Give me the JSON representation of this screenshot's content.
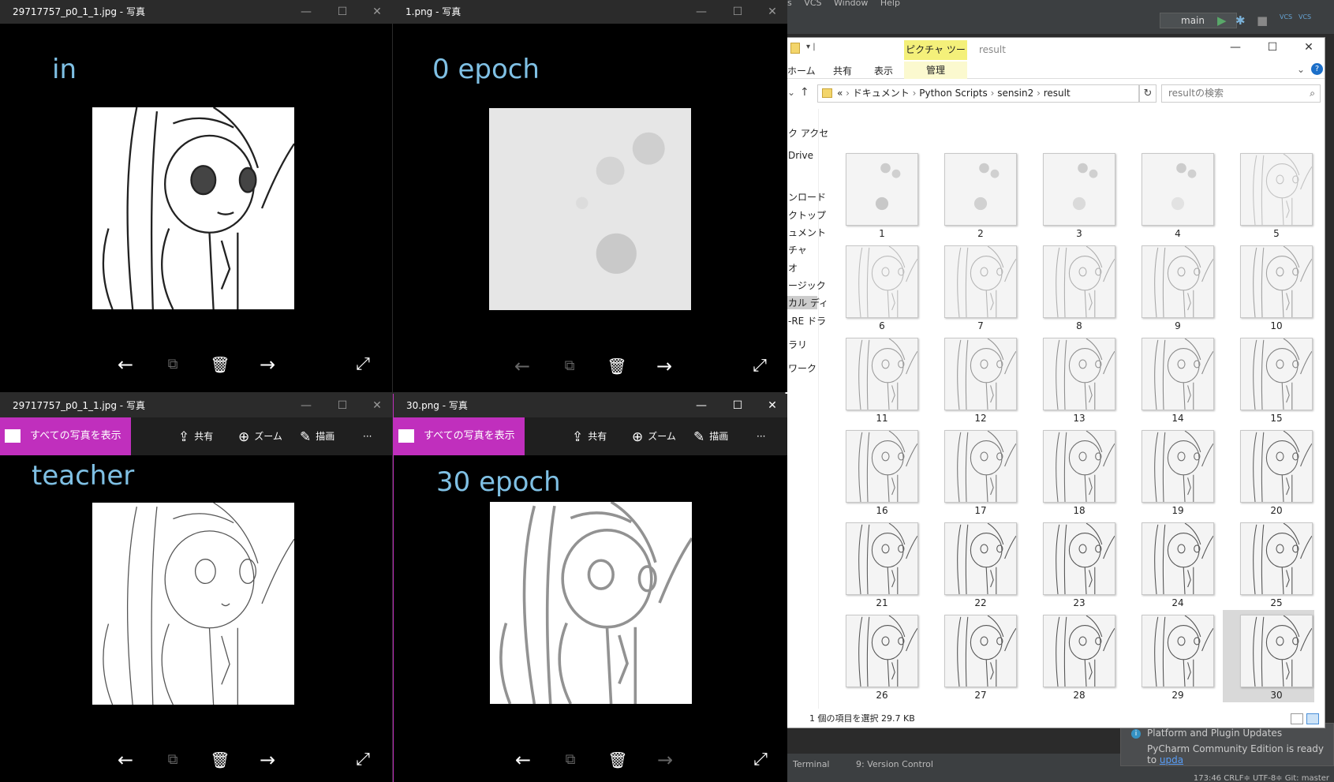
{
  "ide": {
    "menu": [
      "ls",
      "VCS",
      "Window",
      "Help"
    ],
    "branch": "main",
    "vcs_labels": [
      "VCS",
      "VCS"
    ],
    "bottom_tabs": [
      "Terminal",
      "9: Version Control"
    ],
    "status": "173:46  CRLF≑  UTF-8≑  Git: master"
  },
  "notification": {
    "title": "Platform and Plugin Updates",
    "body": "PyCharm Community Edition is ready to ",
    "link": "upda"
  },
  "explorer": {
    "title": "result",
    "tool_tab": "ピクチャ ツール",
    "ribbon": [
      "ホーム",
      "共有",
      "表示",
      "管理"
    ],
    "address": [
      "«",
      "ドキュメント",
      "Python Scripts",
      "sensin2",
      "result"
    ],
    "search_placeholder": "resultの検索",
    "nav_items": [
      "ク アクセ",
      "Drive",
      "ンロード",
      "クトップ",
      "ュメント",
      "チャ",
      "オ",
      "ージック",
      "カル ディ",
      "-RE ドラ",
      "ラリ",
      "ワーク"
    ],
    "files": [
      "1",
      "2",
      "3",
      "4",
      "5",
      "6",
      "7",
      "8",
      "9",
      "10",
      "11",
      "12",
      "13",
      "14",
      "15",
      "16",
      "17",
      "18",
      "19",
      "20",
      "21",
      "22",
      "23",
      "24",
      "25",
      "26",
      "27",
      "28",
      "29",
      "30"
    ],
    "selected": "30",
    "status": "1 個の項目を選択  29.7 KB"
  },
  "windows": {
    "tl": {
      "title": "29717757_p0_1_1.jpg - 写真",
      "caption": "in"
    },
    "tr": {
      "title": "1.png - 写真",
      "caption": "0 epoch"
    },
    "bl": {
      "title": "29717757_p0_1_1.jpg - 写真",
      "caption": "teacher"
    },
    "br": {
      "title": "30.png - 写真",
      "caption": "30 epoch"
    }
  },
  "photo_toolbar": {
    "show_all": "すべての写真を表示",
    "share": "共有",
    "zoom": "ズーム",
    "draw": "描画",
    "more": "···"
  },
  "controls": {
    "minimize": "—",
    "maximize": "☐",
    "close": "✕"
  },
  "icons": {
    "prev": "arrow-left-icon",
    "slideshow": "slideshow-icon",
    "delete": "trash-icon",
    "next": "arrow-right-icon",
    "fullscreen": "expand-icon"
  },
  "colors": {
    "accent": "#c02fbd",
    "caption": "#7fc0e4",
    "tool_tab": "#f4f07a"
  }
}
